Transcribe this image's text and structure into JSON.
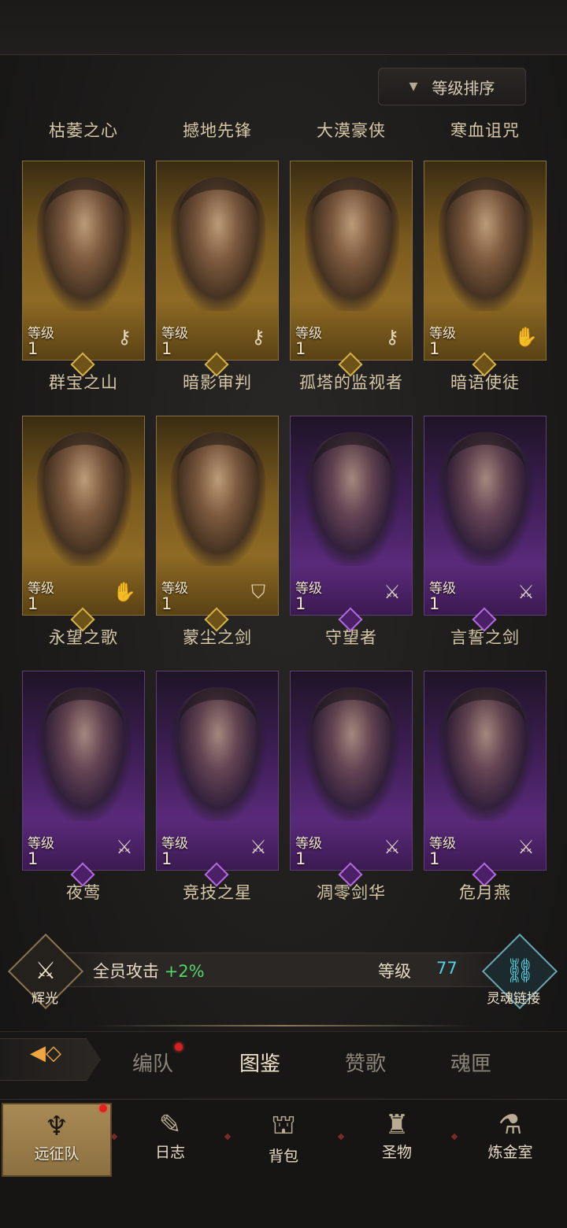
{
  "sort": {
    "label": "等级排序",
    "icon": "triangle-down-icon"
  },
  "top_row_titles": [
    "枯萎之心",
    "撼地先锋",
    "大漠豪侠",
    "寒血诅咒"
  ],
  "heroes": [
    {
      "rarity": "gold",
      "level_label": "等级",
      "level": "1",
      "class_icon": "magic-key-icon",
      "name": "群宝之山"
    },
    {
      "rarity": "gold",
      "level_label": "等级",
      "level": "1",
      "class_icon": "magic-key-icon",
      "name": "暗影审判"
    },
    {
      "rarity": "gold",
      "level_label": "等级",
      "level": "1",
      "class_icon": "magic-key-icon",
      "name": "孤塔的监视者"
    },
    {
      "rarity": "gold",
      "level_label": "等级",
      "level": "1",
      "class_icon": "hand-sigil-icon",
      "name": "暗语使徒"
    },
    {
      "rarity": "gold",
      "level_label": "等级",
      "level": "1",
      "class_icon": "hand-sigil-icon",
      "name": "永望之歌"
    },
    {
      "rarity": "gold",
      "level_label": "等级",
      "level": "1",
      "class_icon": "shield-icon",
      "name": "蒙尘之剑"
    },
    {
      "rarity": "purple",
      "level_label": "等级",
      "level": "1",
      "class_icon": "sword-icon",
      "name": "守望者"
    },
    {
      "rarity": "purple",
      "level_label": "等级",
      "level": "1",
      "class_icon": "sword-icon",
      "name": "言誓之剑"
    },
    {
      "rarity": "purple",
      "level_label": "等级",
      "level": "1",
      "class_icon": "sword-icon",
      "name": "夜莺"
    },
    {
      "rarity": "purple",
      "level_label": "等级",
      "level": "1",
      "class_icon": "sword-icon",
      "name": "竞技之星"
    },
    {
      "rarity": "purple",
      "level_label": "等级",
      "level": "1",
      "class_icon": "sword-icon",
      "name": "凋零剑华"
    },
    {
      "rarity": "purple",
      "level_label": "等级",
      "level": "1",
      "class_icon": "sword-icon",
      "name": "危月燕"
    }
  ],
  "bonus": {
    "left_emblem_label": "辉光",
    "left_emblem_icon": "sword-crest-icon",
    "text": "全员攻击",
    "value": "+2%",
    "level_label": "等级",
    "level_value": "77",
    "right_emblem_label": "灵魂链接",
    "right_emblem_icon": "soul-link-icon"
  },
  "tabs": {
    "items": [
      "编队",
      "图鉴",
      "赞歌",
      "魂匣"
    ],
    "active": "图鉴",
    "back_icon": "back-arrow-icon"
  },
  "nav": {
    "items": [
      {
        "label": "远征队",
        "icon": "viking-helmet-icon",
        "active": true
      },
      {
        "label": "日志",
        "icon": "scroll-icon",
        "active": false
      },
      {
        "label": "背包",
        "icon": "backpack-icon",
        "active": false
      },
      {
        "label": "圣物",
        "icon": "chalice-icon",
        "active": false
      },
      {
        "label": "炼金室",
        "icon": "alchemy-icon",
        "active": false
      }
    ]
  },
  "colors": {
    "gold_card": "#8e6a24",
    "purple_card": "#5a2a7a",
    "bonus_green": "#55d66a",
    "level_cyan": "#4fd1e8",
    "notify_red": "#d81e1e"
  }
}
